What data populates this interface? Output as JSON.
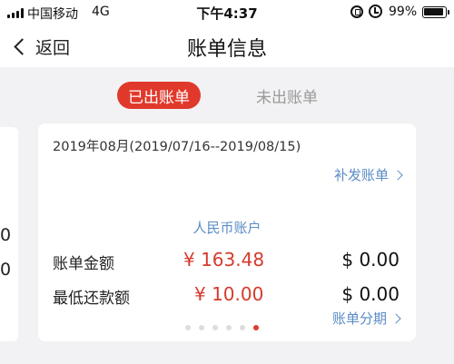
{
  "status_bar": {
    "carrier": "中国移动",
    "network": "4G",
    "time": "下午4:37",
    "battery": "99%"
  },
  "nav": {
    "back_label": "返回",
    "title": "账单信息"
  },
  "tabs": {
    "active": "已出账单",
    "inactive": "未出账单"
  },
  "prev_card": {
    "row1": "0",
    "row2": "0"
  },
  "card": {
    "period": "2019年08月(2019/07/16--2019/08/15)",
    "reissue_label": "补发账单",
    "account_type": "人民币账户",
    "rows": [
      {
        "label": "账单金额",
        "cny": "¥ 163.48",
        "usd": "$ 0.00"
      },
      {
        "label": "最低还款额",
        "cny": "¥ 10.00",
        "usd": "$ 0.00"
      }
    ],
    "installment_label": "账单分期"
  },
  "pager": {
    "count": 6,
    "active_index": 5
  },
  "colors": {
    "accent": "#e0392b",
    "link": "#5b8cc6",
    "amount_red": "#d73a2c"
  }
}
